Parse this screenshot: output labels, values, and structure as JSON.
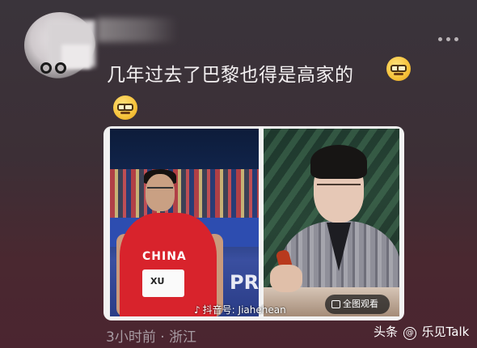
{
  "comment": {
    "text": "几年过去了巴黎也得是高家的",
    "emoji_1": "smug-glasses-emoji",
    "emoji_2": "smug-glasses-emoji",
    "more_icon": "more-dots-icon"
  },
  "image_card": {
    "left_photo": {
      "jersey_text": "CHINA",
      "bib_text": "XU",
      "background_text": "PR"
    },
    "watermark": {
      "icon": "tiktok-icon",
      "text": "抖音号: Jiahehean"
    },
    "fullimage_button": {
      "icon": "image-icon",
      "label": "全图观看"
    }
  },
  "meta": {
    "time_location": "3小时前 · 浙江"
  },
  "brand": {
    "prefix": "头条",
    "icon": "at-icon",
    "name": "乐见Talk"
  },
  "colors": {
    "background_top": "#3a343b",
    "background_bottom": "#4b2530",
    "meta_text": "#a89ca3"
  }
}
